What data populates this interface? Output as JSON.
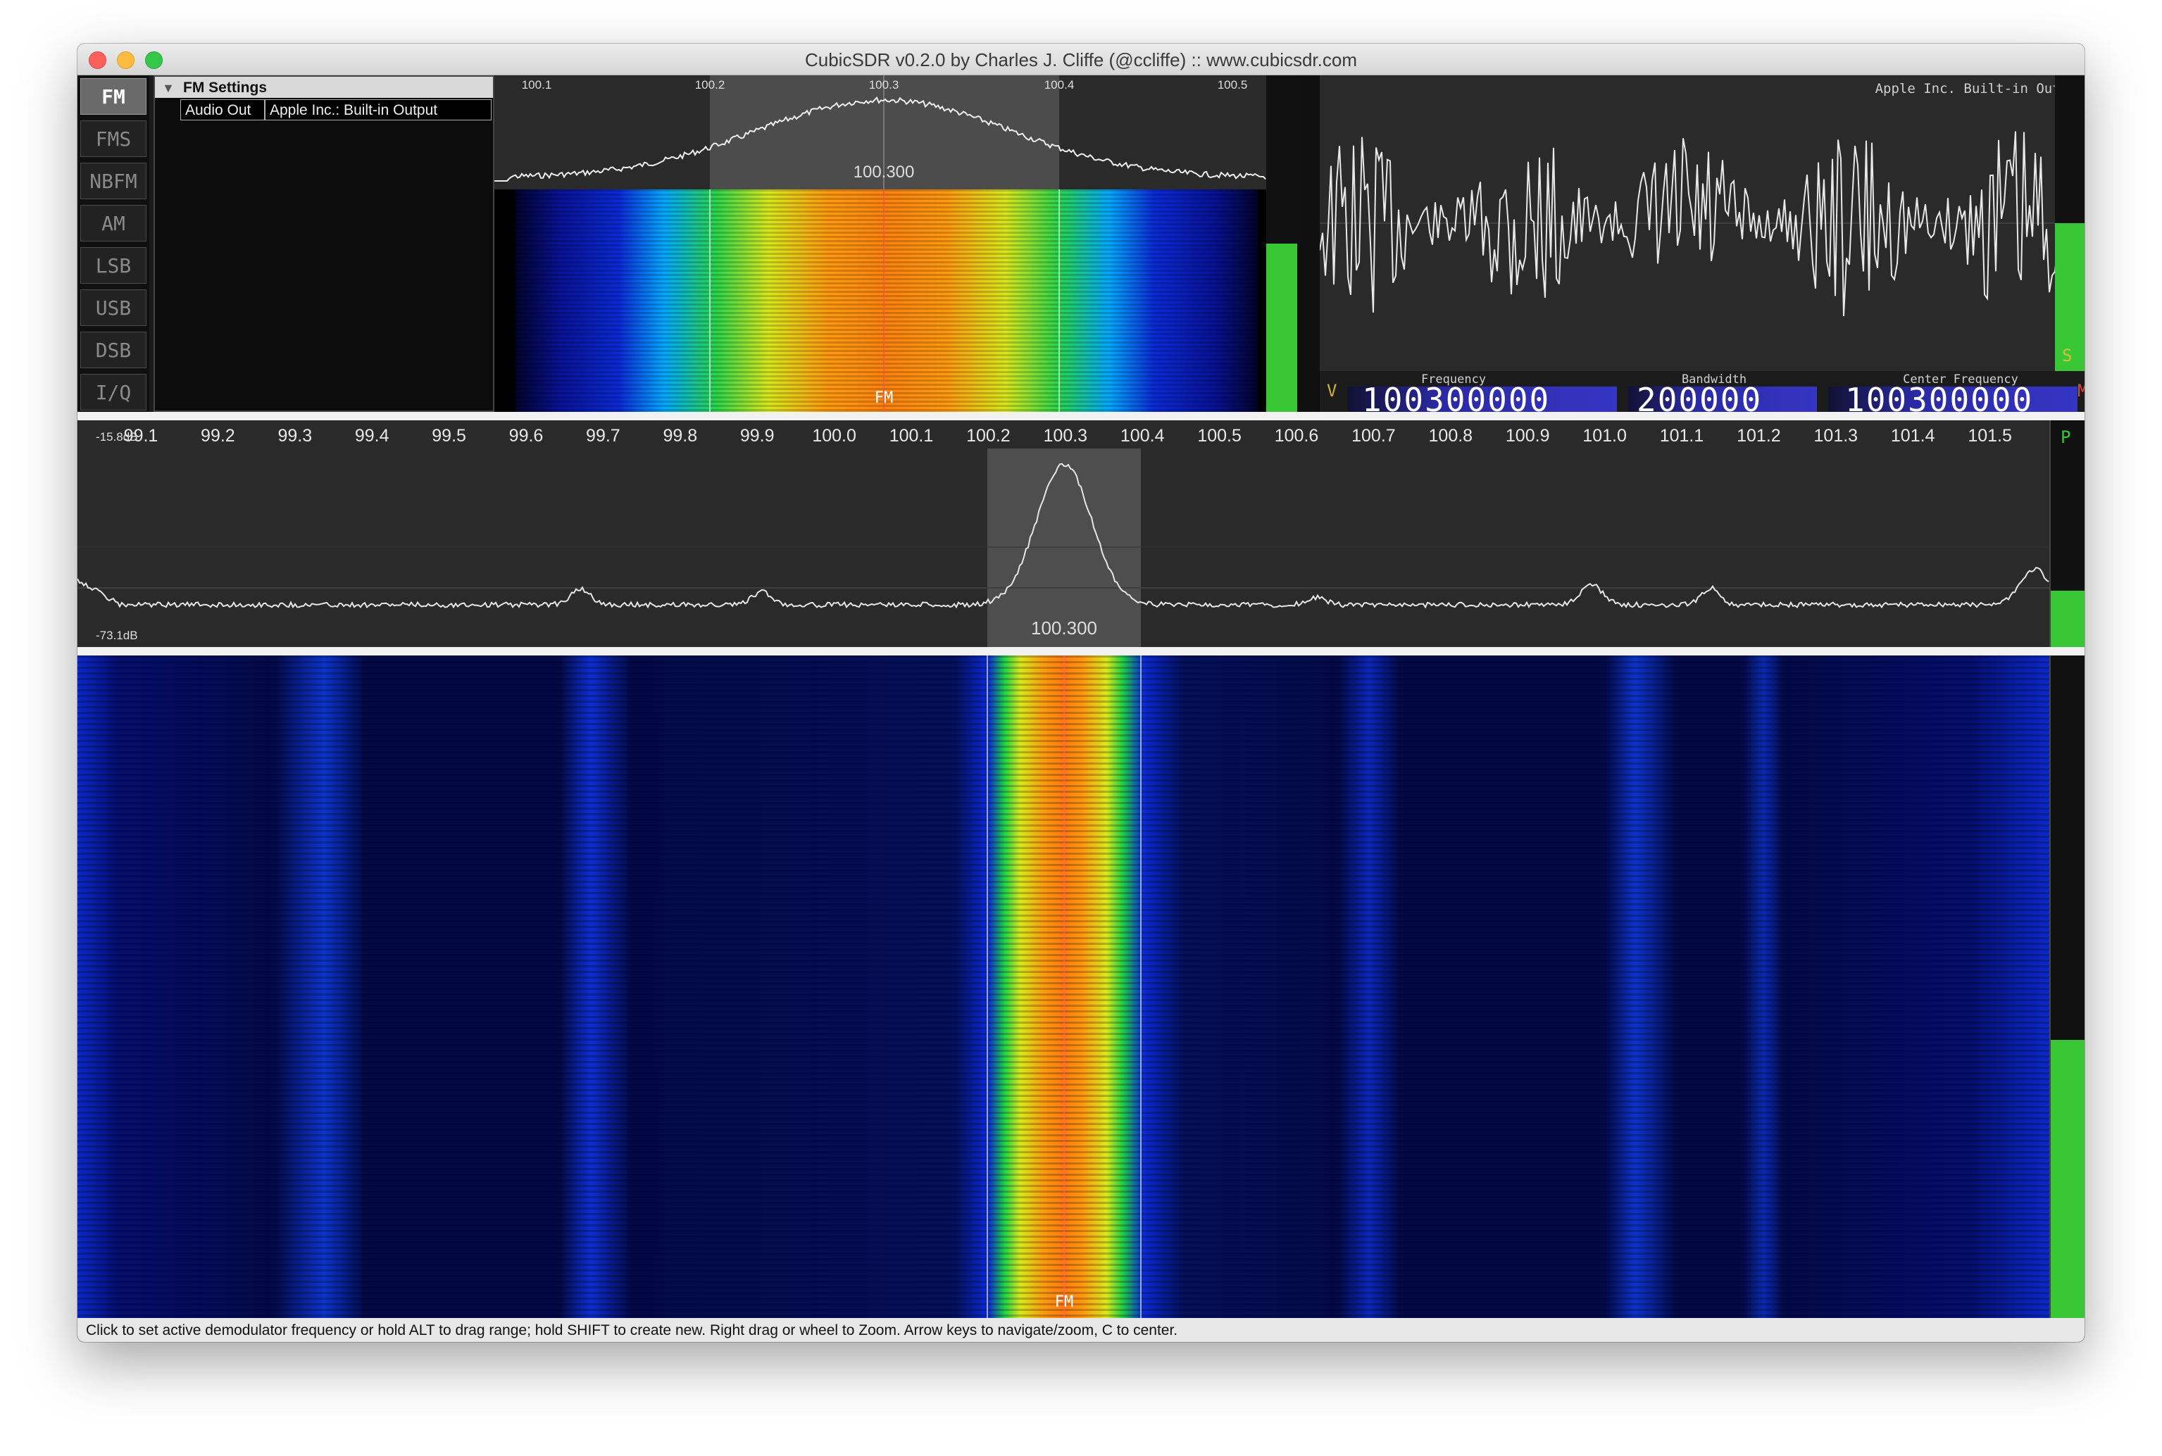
{
  "window": {
    "title": "CubicSDR v0.2.0 by Charles J. Cliffe (@ccliffe)  ::  www.cubicsdr.com"
  },
  "modes": {
    "items": [
      {
        "label": "FM",
        "active": true
      },
      {
        "label": "FMS",
        "active": false
      },
      {
        "label": "NBFM",
        "active": false
      },
      {
        "label": "AM",
        "active": false
      },
      {
        "label": "LSB",
        "active": false
      },
      {
        "label": "USB",
        "active": false
      },
      {
        "label": "DSB",
        "active": false
      },
      {
        "label": "I/Q",
        "active": false
      }
    ]
  },
  "settings": {
    "header": "FM Settings",
    "audio_out_label": "Audio Out",
    "audio_out_value": "Apple Inc.: Built-in Output"
  },
  "demod_spectrum": {
    "ticks": [
      "100.1",
      "100.2",
      "100.3",
      "100.4",
      "100.5"
    ],
    "center_label": "100.300",
    "mode_tag": "FM"
  },
  "scope": {
    "device_label": "Apple Inc. Built-in Output"
  },
  "freq_display": {
    "frequency_label": "Frequency",
    "frequency_value": "100300000",
    "bandwidth_label": "Bandwidth",
    "bandwidth_value": "200000",
    "center_label": "Center Frequency",
    "center_value": "100300000",
    "left_letter": "V",
    "s_letter": "S",
    "m_letter": "M"
  },
  "main_spectrum": {
    "ticks": [
      "99.1",
      "99.2",
      "99.3",
      "99.4",
      "99.5",
      "99.6",
      "99.7",
      "99.8",
      "99.9",
      "100.0",
      "100.1",
      "100.2",
      "100.3",
      "100.4",
      "100.5",
      "100.6",
      "100.7",
      "100.8",
      "100.9",
      "101.0",
      "101.1",
      "101.2",
      "101.3",
      "101.4",
      "101.5"
    ],
    "db_top": "-15.8dB",
    "db_bottom": "-73.1dB",
    "center_label": "100.300",
    "p_letter": "P"
  },
  "main_waterfall": {
    "mode_tag": "FM"
  },
  "meters": {
    "demod_level": 0.5,
    "scope_level": 0.5,
    "spectrum_level": 0.25,
    "waterfall_level": 0.42
  },
  "status": {
    "text": "Click to set active demodulator frequency or hold ALT to drag range; hold SHIFT to create new.  Right drag or wheel to Zoom.  Arrow keys to navigate/zoom, C to center."
  }
}
